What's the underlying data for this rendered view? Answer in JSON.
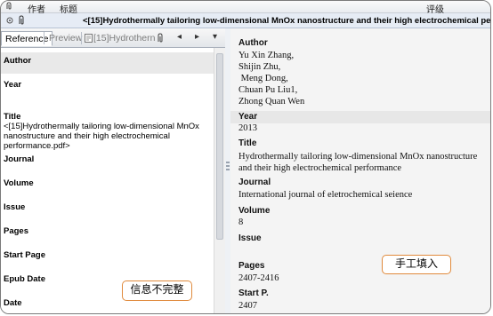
{
  "column_header": {
    "author_col": "作者",
    "title_col": "标题",
    "rating_col": "评级"
  },
  "reference_bar": {
    "title": "<[15]Hydrothermally tailoring low-dimensional MnOx nanostructure and their high electrochemical performance.pdf>"
  },
  "left_tabs": {
    "reference": "Reference",
    "preview": "Preview",
    "attachment": "[15]Hydrothern",
    "prev": "◂",
    "next": "▸",
    "menu": "▾"
  },
  "left_fields": {
    "author": "Author",
    "year": "Year",
    "title": "Title",
    "title_value": "<[15]Hydrothermally tailoring low-dimensional MnOx nanostructure and their high electrochemical performance.pdf>",
    "journal": "Journal",
    "volume": "Volume",
    "issue": "Issue",
    "pages": "Pages",
    "start_page": "Start Page",
    "epub_date": "Epub Date",
    "date": "Date"
  },
  "notes": {
    "incomplete": "信息不完整",
    "manual": "手工填入"
  },
  "right_fields": {
    "author_label": "Author",
    "authors": [
      "Yu Xin Zhang,",
      "Shijin Zhu,",
      " Meng Dong,",
      "Chuan Pu Liu1,",
      "Zhong Quan Wen"
    ],
    "year_label": "Year",
    "year_value": "2013",
    "title_label": "Title",
    "title_value": "Hydrothermally tailoring low-dimensional MnOx nanostructure and their high electrochemical performance",
    "journal_label": "Journal",
    "journal_value": "International journal of eletrochemical seience",
    "volume_label": "Volume",
    "volume_value": "8",
    "issue_label": "Issue",
    "pages_label": "Pages",
    "pages_value": "2407-2416",
    "start_label": "Start P.",
    "start_value": "2407"
  },
  "icons": [
    "paperclip-icon",
    "pin-icon",
    "pdf-icon",
    "attachment-icon",
    "splitter-grip-icon"
  ],
  "colors": {
    "note_border": "#e08a3c",
    "title_bar_bg": "#e6ecf5",
    "right_pane_bg": "#f4f4f4"
  }
}
